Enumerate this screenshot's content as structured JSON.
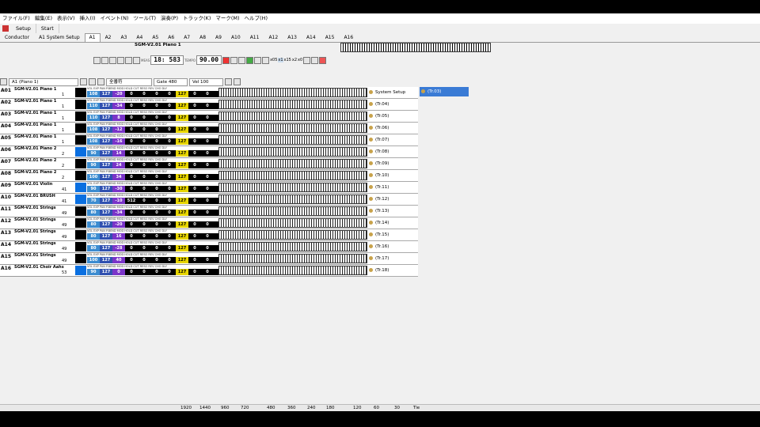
{
  "menu": [
    "ファイル(F)",
    "編集(E)",
    "表示(V)",
    "挿入(I)",
    "イベント(N)",
    "ツール(T)",
    "演奏(P)",
    "トラック(K)",
    "マーク(M)",
    "ヘルプ(H)"
  ],
  "top_buttons": {
    "setup": "Setup",
    "start": "Start"
  },
  "tabs": [
    "Conductor",
    "A1 System Setup",
    "A1",
    "A2",
    "A3",
    "A4",
    "A5",
    "A6",
    "A7",
    "A8",
    "A9",
    "A10",
    "A11",
    "A12",
    "A13",
    "A14",
    "A15",
    "A16"
  ],
  "transport": {
    "track_name": "SGM-V2.01 Piano 1",
    "meas_label": "MEAS",
    "position": "18: 583",
    "tempo_label": "TEMPO",
    "tempo": "90.00",
    "speed": [
      "x05",
      "x1",
      "x15",
      "x2",
      "x0"
    ]
  },
  "toolbar_left": {
    "track_select": "A1 (Piano 1)",
    "filter": "全番符",
    "gate": "Gate 480",
    "vel": "Vel 100"
  },
  "tracks": [
    {
      "id": "A01",
      "name": "SGM-V2.01 Piano 1",
      "pc": "1",
      "vals": [
        "108",
        "127",
        "-20",
        "0",
        "0",
        "0",
        "0",
        "127",
        "0",
        "0"
      ],
      "color": "black"
    },
    {
      "id": "A02",
      "name": "SGM-V2.01 Piano 1",
      "pc": "1",
      "vals": [
        "110",
        "127",
        "-34",
        "0",
        "0",
        "0",
        "0",
        "127",
        "0",
        "0"
      ],
      "color": "black"
    },
    {
      "id": "A03",
      "name": "SGM-V2.01 Piano 1",
      "pc": "1",
      "vals": [
        "110",
        "127",
        "8",
        "0",
        "0",
        "0",
        "0",
        "127",
        "0",
        "0"
      ],
      "color": "black"
    },
    {
      "id": "A04",
      "name": "SGM-V2.01 Piano 1",
      "pc": "1",
      "vals": [
        "108",
        "127",
        "-12",
        "0",
        "0",
        "0",
        "0",
        "127",
        "0",
        "0"
      ],
      "color": "black"
    },
    {
      "id": "A05",
      "name": "SGM-V2.01 Piano 1",
      "pc": "1",
      "vals": [
        "108",
        "127",
        "-16",
        "0",
        "0",
        "0",
        "0",
        "127",
        "0",
        "0"
      ],
      "color": "black"
    },
    {
      "id": "A06",
      "name": "SGM-V2.01 Piano 2",
      "pc": "2",
      "vals": [
        "90",
        "127",
        "14",
        "0",
        "0",
        "0",
        "0",
        "127",
        "0",
        "0"
      ],
      "color": "blue"
    },
    {
      "id": "A07",
      "name": "SGM-V2.01 Piano 2",
      "pc": "2",
      "vals": [
        "90",
        "127",
        "24",
        "0",
        "0",
        "0",
        "0",
        "127",
        "0",
        "0"
      ],
      "color": "black"
    },
    {
      "id": "A08",
      "name": "SGM-V2.01 Piano 2",
      "pc": "2",
      "vals": [
        "100",
        "127",
        "34",
        "0",
        "0",
        "0",
        "0",
        "127",
        "0",
        "0"
      ],
      "color": "black"
    },
    {
      "id": "A09",
      "name": "SGM-V2.01 Violin",
      "pc": "41",
      "vals": [
        "90",
        "127",
        "-30",
        "0",
        "0",
        "0",
        "0",
        "127",
        "0",
        "0"
      ],
      "color": "blue"
    },
    {
      "id": "A10",
      "name": "SGM-V2.01 BRUSH",
      "pc": "41",
      "vals": [
        "70",
        "127",
        "-10",
        "512",
        "0",
        "0",
        "0",
        "127",
        "0",
        "0"
      ],
      "color": "blue"
    },
    {
      "id": "A11",
      "name": "SGM-V2.01 Strings",
      "pc": "49",
      "vals": [
        "80",
        "127",
        "-34",
        "0",
        "0",
        "0",
        "0",
        "127",
        "0",
        "0"
      ],
      "color": "black"
    },
    {
      "id": "A12",
      "name": "SGM-V2.01 Strings",
      "pc": "49",
      "vals": [
        "80",
        "127",
        "-20",
        "0",
        "0",
        "0",
        "0",
        "127",
        "0",
        "0"
      ],
      "color": "black"
    },
    {
      "id": "A13",
      "name": "SGM-V2.01 Strings",
      "pc": "49",
      "vals": [
        "80",
        "127",
        "16",
        "0",
        "0",
        "0",
        "0",
        "127",
        "0",
        "0"
      ],
      "color": "black"
    },
    {
      "id": "A14",
      "name": "SGM-V2.01 Strings",
      "pc": "49",
      "vals": [
        "80",
        "127",
        "-28",
        "0",
        "0",
        "0",
        "0",
        "127",
        "0",
        "0"
      ],
      "color": "black"
    },
    {
      "id": "A15",
      "name": "SGM-V2.01 Strings",
      "pc": "49",
      "vals": [
        "100",
        "127",
        "40",
        "0",
        "0",
        "0",
        "0",
        "127",
        "0",
        "0"
      ],
      "color": "black"
    },
    {
      "id": "A16",
      "name": "SGM-V2.01 Choir Aahs",
      "pc": "53",
      "vals": [
        "90",
        "127",
        "0",
        "0",
        "0",
        "0",
        "0",
        "127",
        "0",
        "0"
      ],
      "color": "blue"
    }
  ],
  "ctrl_headers": "VOL EXP PAN P.BEND MOD HOLD CUT RESO REV CHO DLY",
  "right_panel": [
    "System Setup",
    "(Tr.04)",
    "(Tr.05)",
    "(Tr.06)",
    "(Tr.07)",
    "(Tr.08)",
    "(Tr.09)",
    "(Tr.10)",
    "(Tr.11)",
    "(Tr.12)",
    "(Tr.13)",
    "(Tr.14)",
    "(Tr.15)",
    "(Tr.16)",
    "(Tr.17)",
    "(Tr.18)"
  ],
  "selected_item": "(Tr.03)",
  "scale": [
    "1920",
    "1440",
    "960",
    "720",
    "480",
    "360",
    "240",
    "180",
    "120",
    "60",
    "30",
    "Tie"
  ]
}
